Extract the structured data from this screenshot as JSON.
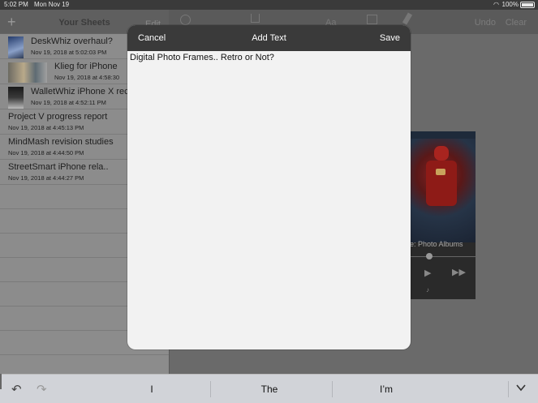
{
  "status": {
    "time": "5:02 PM",
    "date": "Mon Nov 19",
    "battery": "100%"
  },
  "sidebar": {
    "title": "Your Sheets",
    "edit_label": "Edit",
    "items": [
      {
        "name": "DeskWhiz overhaul?",
        "stamp": "Nov 19, 2018 at 5:02:03 PM"
      },
      {
        "name": "Klieg for iPhone",
        "stamp": "Nov 19, 2018 at 4:58:30"
      },
      {
        "name": "WalletWhiz iPhone X rec",
        "stamp": "Nov 19, 2018 at 4:52:11 PM"
      },
      {
        "name": "Project V progress report",
        "stamp": "Nov 19, 2018 at 4:45:13 PM"
      },
      {
        "name": "MindMash revision studies",
        "stamp": "Nov 19, 2018 at 4:44:50 PM"
      },
      {
        "name": "StreetSmart iPhone rela..",
        "stamp": "Nov 19, 2018 at 4:44:27 PM"
      }
    ]
  },
  "toolbar": {
    "font_label": "Aa",
    "undo_label": "Undo",
    "clear_label": "Clear"
  },
  "photo_card": {
    "caption": "e: Photo Albums"
  },
  "modal": {
    "cancel_label": "Cancel",
    "title": "Add Text",
    "save_label": "Save",
    "text": "Digital Photo Frames.. Retro or Not?"
  },
  "keyboard": {
    "suggestions": [
      "I",
      "The",
      "I’m"
    ]
  },
  "colors": {
    "modal_header": "#3a3a3a",
    "modal_bg": "#f2f2f2",
    "sidebar_bg": "#8c8c8c"
  }
}
